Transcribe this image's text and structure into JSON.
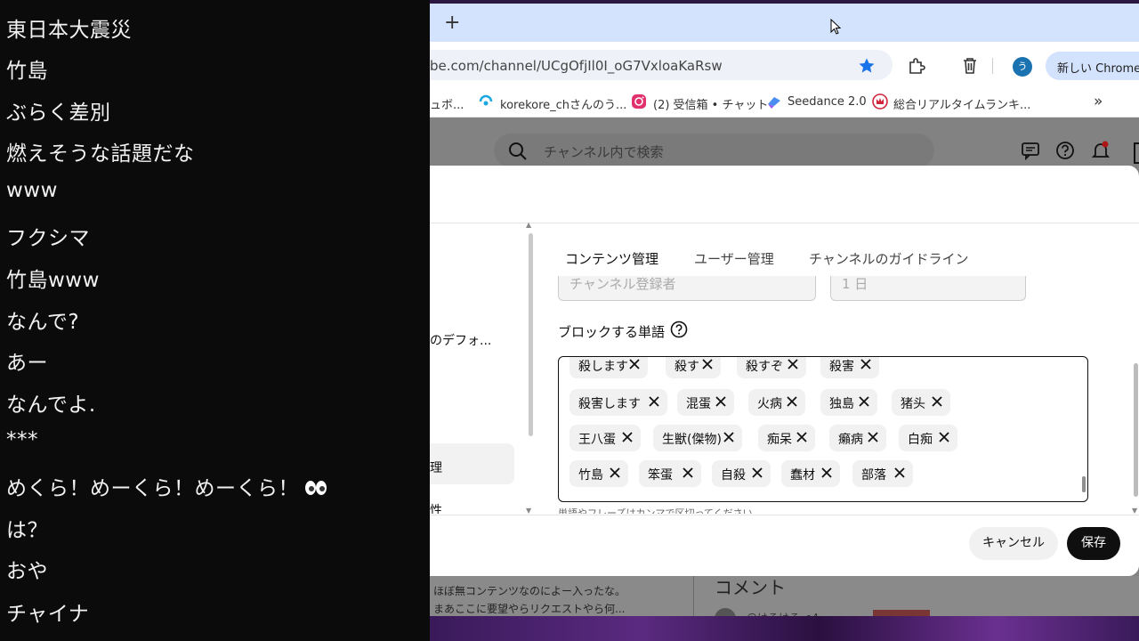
{
  "chat": {
    "messages": [
      "東日本大震災",
      "竹島",
      "ぶらく差別",
      "燃えそうな話題だな",
      "www",
      "フクシマ",
      "竹島www",
      "なんで?",
      "あー",
      "なんでよ.",
      "***",
      "めくら！めーくら！めーくら！",
      "は？",
      "おや",
      "チャイナ"
    ]
  },
  "browser": {
    "new_tab_symbol": "+",
    "url": "be.com/channel/UCgOfjIl0I_oG7VxloaKaRsw",
    "new_chrome_label": "新しい Chrome を",
    "avatar_letter": "う",
    "bookmarks": [
      {
        "label": "ュボ...",
        "icon": "none"
      },
      {
        "label": "korekore_chさんのう...",
        "icon": "stream-icon"
      },
      {
        "label": "(2) 受信箱 • チャット",
        "icon": "instagram-icon"
      },
      {
        "label": "Seedance 2.0",
        "icon": "seedance-icon"
      },
      {
        "label": "総合リアルタイムランキ...",
        "icon": "crown-icon"
      }
    ],
    "more_bookmarks": "»"
  },
  "page": {
    "search_placeholder": "チャンネル内で検索",
    "bottom_text_1": "ほぼ無コンテンツなのによー入ったな。",
    "bottom_text_2": "まあここに要望やらリクエストやら何...",
    "comments_heading": "コメント",
    "comment_user": "@はるはる_e4"
  },
  "modal": {
    "sidebar": {
      "item_default": "のデフォ...",
      "item_manage": "理",
      "item_bottom": "性"
    },
    "tabs": [
      "コンテンツ管理",
      "ユーザー管理",
      "チャンネルのガイドライン"
    ],
    "dropdown_1": "チャンネル登録者",
    "dropdown_2": "1 日",
    "block_words_label": "ブロックする単語",
    "help_icon": "?",
    "blocked_words": [
      [
        "殺します",
        "殺す",
        "殺すぞ",
        "殺害"
      ],
      [
        "殺害します",
        "混蛋",
        "火病",
        "独島",
        "猪头"
      ],
      [
        "王八蛋",
        "生獣(傑物)",
        "痴呆",
        "癩病",
        "白痴"
      ],
      [
        "竹島",
        "笨蛋",
        "自殺",
        "蠢材",
        "部落"
      ]
    ],
    "hint": "単語やフレーズはカンマで区切ってください。",
    "cancel_label": "キャンセル",
    "save_label": "保存"
  },
  "colors": {
    "accent_blue": "#1a73e8",
    "tab_strip": "#d3e2fd",
    "chat_bg": "#0b0b0b",
    "save_bg": "#0f0f0f"
  }
}
